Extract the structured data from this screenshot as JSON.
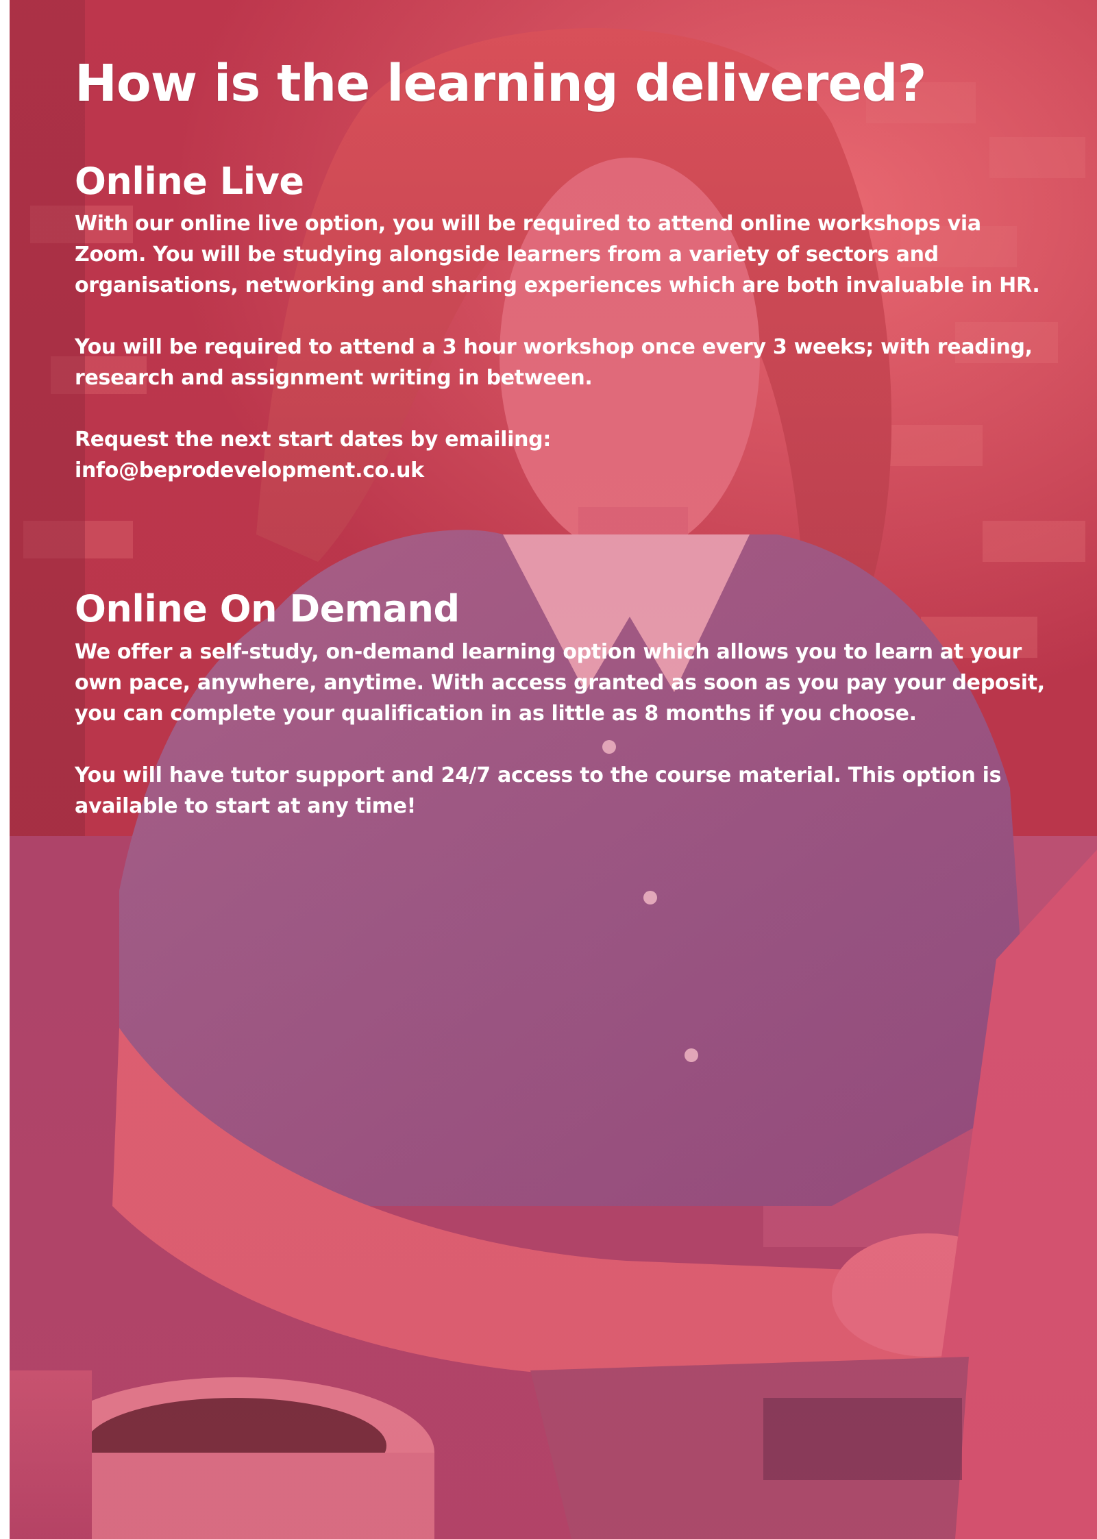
{
  "title": "How is the learning delivered?",
  "online_live": {
    "heading": "Online Live",
    "paragraphs": [
      "With our online live option, you will be required to attend online workshops via Zoom. You will be studying alongside learners from a variety of sectors and organisations, networking and sharing experiences which are both invaluable in HR.",
      "You will be required to attend a 3 hour workshop once every 3 weeks; with reading, research and assignment writing in between.",
      "Request the next start dates by emailing:",
      "info@beprodevelopment.co.uk"
    ]
  },
  "online_on_demand": {
    "heading": "Online On Demand",
    "paragraphs": [
      "We offer a self-study, on-demand learning option which allows you to learn at your own pace, anywhere, anytime. With access granted as soon as you pay your deposit, you can complete your qualification in as little as 8 months if you choose.",
      "You will have tutor support and 24/7 access to the course material. This option is available to start at any time!"
    ]
  },
  "colors": {
    "overlay": "#d63c56",
    "text": "#ffffff"
  }
}
